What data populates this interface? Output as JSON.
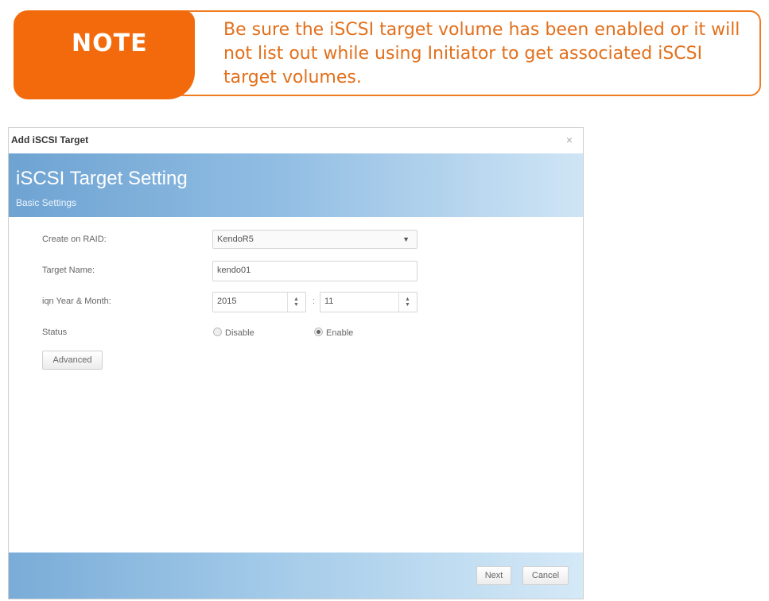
{
  "note": {
    "label": "NOTE",
    "text": "Be sure the iSCSI target volume has been enabled or it will not list out while using Initiator to get associated iSCSI target volumes."
  },
  "dialog": {
    "title": "Add iSCSI Target",
    "close_glyph": "×",
    "header": {
      "title": "iSCSI Target Setting",
      "subtitle": "Basic Settings"
    },
    "form": {
      "raid": {
        "label": "Create on RAID:",
        "value": "KendoR5"
      },
      "target_name": {
        "label": "Target Name:",
        "value": "kendo01"
      },
      "iqn": {
        "label": "iqn Year & Month:",
        "year": "2015",
        "month": "11",
        "separator": ":"
      },
      "status": {
        "label": "Status",
        "options": [
          "Disable",
          "Enable"
        ],
        "selected": "Enable"
      },
      "advanced_label": "Advanced"
    },
    "footer": {
      "next_label": "Next",
      "cancel_label": "Cancel"
    }
  },
  "colors": {
    "note_orange": "#f26a0c",
    "header_blue": "#6ea3d2"
  }
}
